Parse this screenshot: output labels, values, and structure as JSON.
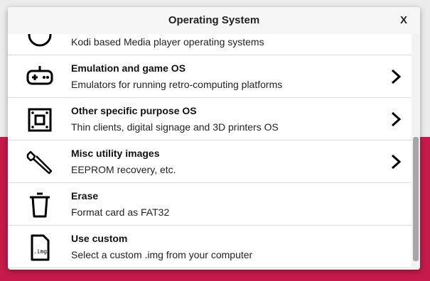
{
  "dialog": {
    "title": "Operating System",
    "close_label": "X"
  },
  "items": [
    {
      "title": "",
      "description": "Kodi based Media player operating systems",
      "icon": "media-player-icon",
      "has_submenu": false
    },
    {
      "title": "Emulation and game OS",
      "description": "Emulators for running retro-computing platforms",
      "icon": "gamepad-icon",
      "has_submenu": true
    },
    {
      "title": "Other specific purpose OS",
      "description": "Thin clients, digital signage and 3D printers OS",
      "icon": "chip-icon",
      "has_submenu": true
    },
    {
      "title": "Misc utility images",
      "description": "EEPROM recovery, etc.",
      "icon": "wrench-icon",
      "has_submenu": true
    },
    {
      "title": "Erase",
      "description": "Format card as FAT32",
      "icon": "trash-icon",
      "has_submenu": false
    },
    {
      "title": "Use custom",
      "description": "Select a custom .img from your computer",
      "icon": "img-file-icon",
      "icon_text": ".img",
      "has_submenu": false
    }
  ],
  "colors": {
    "background_accent": "#c51a4a",
    "dialog_background": "#ffffff"
  }
}
